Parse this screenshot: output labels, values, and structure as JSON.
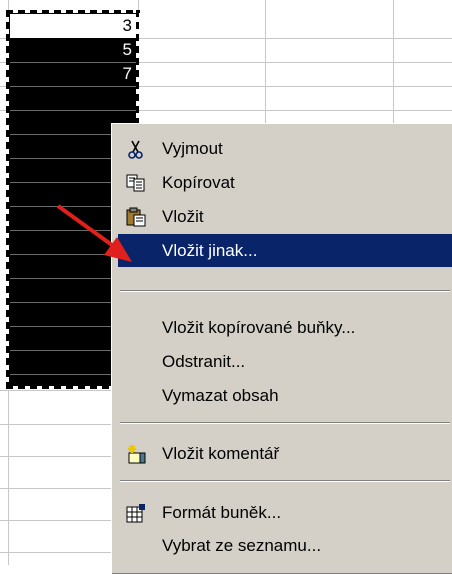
{
  "sheet": {
    "cells": [
      "3",
      "5",
      "7"
    ]
  },
  "context_menu": {
    "items": [
      {
        "label": "Vyjmout",
        "icon": "scissors-icon"
      },
      {
        "label": "Kopírovat",
        "icon": "copy-icon"
      },
      {
        "label": "Vložit",
        "icon": "clipboard-paste-icon"
      },
      {
        "label": "Vložit jinak...",
        "icon": "",
        "highlighted": true
      },
      {
        "label": "Vložit kopírované buňky...",
        "icon": ""
      },
      {
        "label": "Odstranit...",
        "icon": ""
      },
      {
        "label": "Vymazat obsah",
        "icon": ""
      },
      {
        "label": "Vložit komentář",
        "icon": "new-comment-icon"
      },
      {
        "label": "Formát buněk...",
        "icon": "format-cells-icon"
      },
      {
        "label": "Vybrat ze seznamu...",
        "icon": ""
      }
    ]
  },
  "colors": {
    "highlight": "#0a246a",
    "menu_bg": "#d4d0c8",
    "arrow": "#e0201c"
  },
  "annotation": {
    "icon": "red-arrow-icon"
  }
}
